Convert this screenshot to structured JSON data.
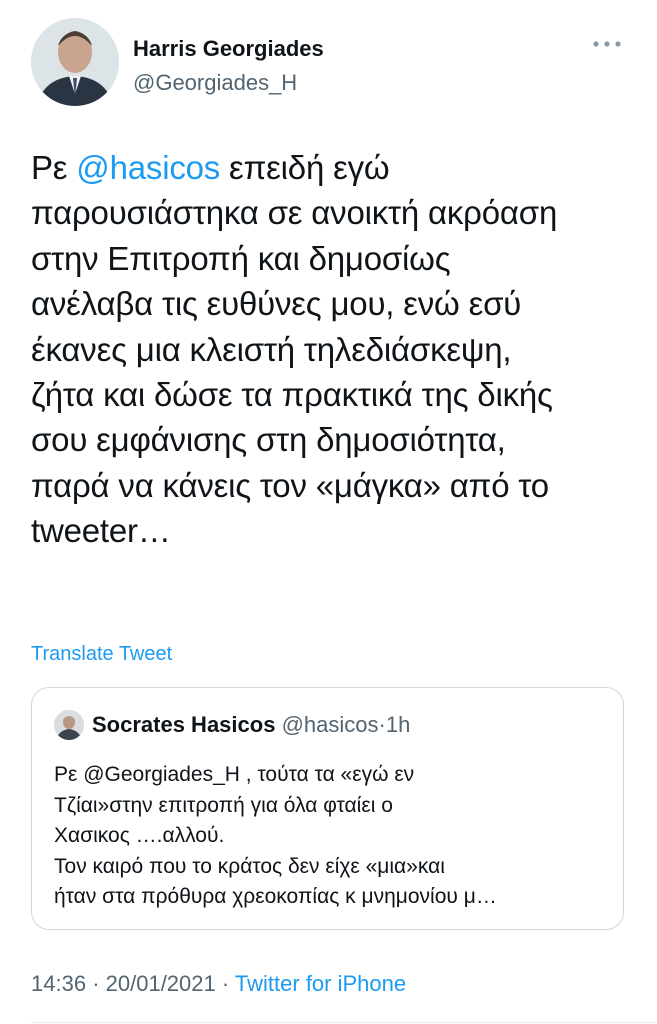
{
  "author": {
    "name": "Harris Georgiades",
    "handle": "@Georgiades_H"
  },
  "tweet": {
    "prefix": "Ρε ",
    "mention": "@hasicos",
    "rest": " επειδή εγώ\nπαρουσιάστηκα σε ανοικτή ακρόαση\nστην Επιτροπή και δημοσίως\nανέλαβα τις ευθύνες μου, ενώ εσύ\nέκανες μια κλειστή τηλεδιάσκεψη,\nζήτα και δώσε τα πρακτικά της δικής\nσου εμφάνισης στη δημοσιότητα,\nπαρά να κάνεις τον «μάγκα» από το\ntweeter…"
  },
  "translate_label": "Translate Tweet",
  "quoted": {
    "name": "Socrates Hasicos",
    "handle": "@hasicos",
    "separator": "·",
    "time": "1h",
    "text": "Ρε @Georgiades_H , τούτα τα «εγώ εν\nΤζίαι»στην επιτροπή για όλα φταίει ο\nΧασικος ….αλλού.\nΤον καιρό που το κράτος δεν είχε «μια»και\nήταν στα πρόθυρα χρεοκοπίας κ μνημονίου μ…"
  },
  "meta": {
    "time": "14:36",
    "separator": "·",
    "date": "20/01/2021",
    "source": "Twitter for iPhone"
  },
  "colors": {
    "link": "#1d9bf0",
    "secondary_text": "#536471",
    "primary_text": "#0f1419",
    "border": "#cfd9de"
  },
  "icons": {
    "more": "more-options-icon",
    "author_avatar": "avatar",
    "quoted_avatar": "avatar"
  }
}
